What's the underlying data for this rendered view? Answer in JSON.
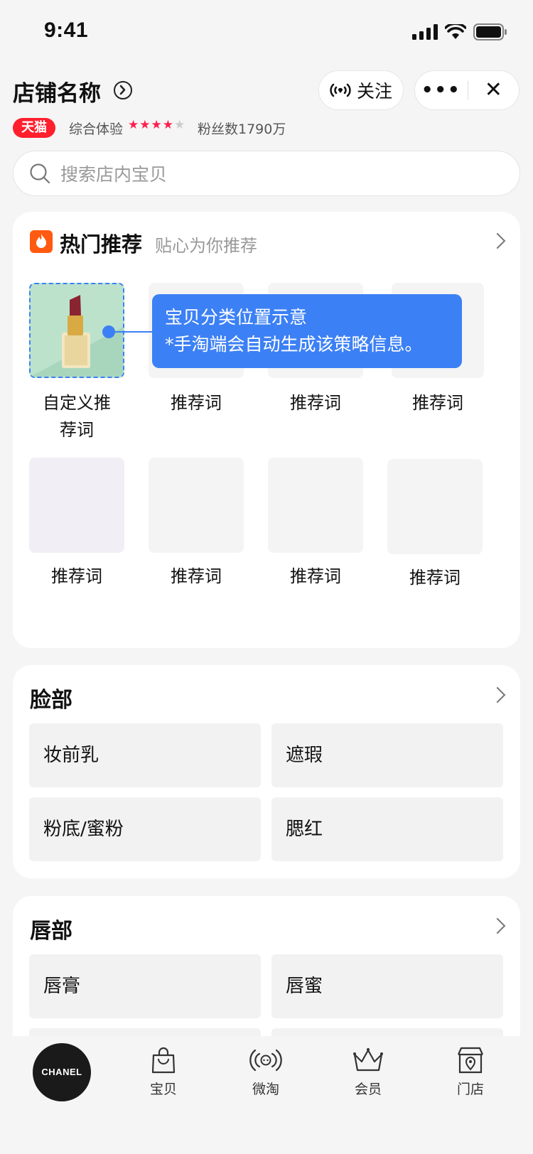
{
  "status_bar": {
    "time": "9:41"
  },
  "header": {
    "store_name": "店铺名称",
    "follow_label": "关注",
    "more_label": "•••",
    "close_label": "✕"
  },
  "store_meta": {
    "badge": "天猫",
    "rating_label": "综合体验",
    "rating_stars": 4,
    "stars_filled": "★★★★",
    "stars_empty": "★",
    "fans": "粉丝数1790万"
  },
  "search": {
    "placeholder": "搜索店内宝贝"
  },
  "hot": {
    "title": "热门推荐",
    "subtitle": "贴心为你推荐",
    "tooltip_line1": "宝贝分类位置示意",
    "tooltip_line2": "*手淘端会自动生成该策略信息。",
    "items": [
      {
        "label": "自定义推\n荐词"
      },
      {
        "label": "推荐词"
      },
      {
        "label": "推荐词"
      },
      {
        "label": "推荐词"
      },
      {
        "label": "推荐词"
      },
      {
        "label": "推荐词"
      },
      {
        "label": "推荐词"
      },
      {
        "label": "推荐词"
      }
    ]
  },
  "face": {
    "title": "脸部",
    "items": [
      "妆前乳",
      "遮瑕",
      "粉底/蜜粉",
      "腮红"
    ]
  },
  "lip": {
    "title": "唇部",
    "items": [
      "唇膏",
      "唇蜜"
    ]
  },
  "bottom_nav": {
    "brand": "CHANEL",
    "items": [
      "宝贝",
      "微淘",
      "会员",
      "门店"
    ]
  },
  "colors": {
    "accent": "#3c80f5",
    "tmall_red": "#ff1f2d",
    "fire": "#ff5a11"
  }
}
